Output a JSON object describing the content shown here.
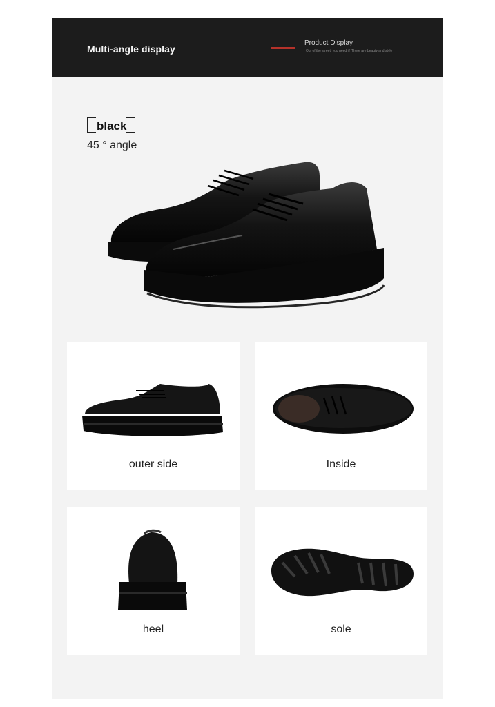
{
  "header": {
    "title": "Multi-angle display",
    "product_display": "Product Display",
    "tagline": "Out of the street, you need it! There are beauty and style"
  },
  "hero": {
    "color": "black",
    "angle": "45 ° angle"
  },
  "views": [
    {
      "label": "outer side"
    },
    {
      "label": "Inside"
    },
    {
      "label": "heel"
    },
    {
      "label": "sole"
    }
  ],
  "colors": {
    "banner": "#1c1c1c",
    "accent": "#b5322a",
    "panel": "#f3f3f3",
    "card": "#ffffff",
    "shoe": "#121212"
  }
}
